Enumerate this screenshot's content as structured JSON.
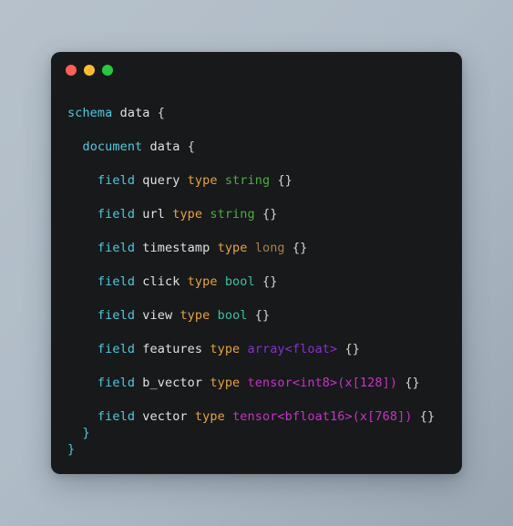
{
  "window": {
    "traffic_lights": [
      {
        "name": "close",
        "color": "#ff5f57"
      },
      {
        "name": "minimize",
        "color": "#febc2e"
      },
      {
        "name": "maximize",
        "color": "#28c840"
      }
    ]
  },
  "code": {
    "language": "vespa-schema",
    "lines": [
      {
        "id": "schema-open",
        "indent": 0,
        "spacing": "gap",
        "tokens": [
          {
            "text": "schema",
            "kind": "kw"
          },
          {
            "text": " ",
            "kind": "plain"
          },
          {
            "text": "data",
            "kind": "name"
          },
          {
            "text": " ",
            "kind": "plain"
          },
          {
            "text": "{",
            "kind": "brace"
          }
        ]
      },
      {
        "id": "document-open",
        "indent": 1,
        "spacing": "gap",
        "tokens": [
          {
            "text": "document",
            "kind": "kw"
          },
          {
            "text": " ",
            "kind": "plain"
          },
          {
            "text": "data",
            "kind": "name"
          },
          {
            "text": " ",
            "kind": "plain"
          },
          {
            "text": "{",
            "kind": "brace"
          }
        ]
      },
      {
        "id": "field-query",
        "indent": 2,
        "spacing": "gap",
        "tokens": [
          {
            "text": "field",
            "kind": "kw"
          },
          {
            "text": " ",
            "kind": "plain"
          },
          {
            "text": "query",
            "kind": "name"
          },
          {
            "text": " ",
            "kind": "plain"
          },
          {
            "text": "type",
            "kind": "type-kw"
          },
          {
            "text": " ",
            "kind": "plain"
          },
          {
            "text": "string",
            "kind": "string"
          },
          {
            "text": " ",
            "kind": "plain"
          },
          {
            "text": "{}",
            "kind": "brace"
          }
        ]
      },
      {
        "id": "field-url",
        "indent": 2,
        "spacing": "gap",
        "tokens": [
          {
            "text": "field",
            "kind": "kw"
          },
          {
            "text": " ",
            "kind": "plain"
          },
          {
            "text": "url",
            "kind": "name"
          },
          {
            "text": " ",
            "kind": "plain"
          },
          {
            "text": "type",
            "kind": "type-kw"
          },
          {
            "text": " ",
            "kind": "plain"
          },
          {
            "text": "string",
            "kind": "string"
          },
          {
            "text": " ",
            "kind": "plain"
          },
          {
            "text": "{}",
            "kind": "brace"
          }
        ]
      },
      {
        "id": "field-timestamp",
        "indent": 2,
        "spacing": "gap",
        "tokens": [
          {
            "text": "field",
            "kind": "kw"
          },
          {
            "text": " ",
            "kind": "plain"
          },
          {
            "text": "timestamp",
            "kind": "name"
          },
          {
            "text": " ",
            "kind": "plain"
          },
          {
            "text": "type",
            "kind": "type-kw"
          },
          {
            "text": " ",
            "kind": "plain"
          },
          {
            "text": "long",
            "kind": "long"
          },
          {
            "text": " ",
            "kind": "plain"
          },
          {
            "text": "{}",
            "kind": "brace"
          }
        ]
      },
      {
        "id": "field-click",
        "indent": 2,
        "spacing": "gap",
        "tokens": [
          {
            "text": "field",
            "kind": "kw"
          },
          {
            "text": " ",
            "kind": "plain"
          },
          {
            "text": "click",
            "kind": "name"
          },
          {
            "text": " ",
            "kind": "plain"
          },
          {
            "text": "type",
            "kind": "type-kw"
          },
          {
            "text": " ",
            "kind": "plain"
          },
          {
            "text": "bool",
            "kind": "bool"
          },
          {
            "text": " ",
            "kind": "plain"
          },
          {
            "text": "{}",
            "kind": "brace"
          }
        ]
      },
      {
        "id": "field-view",
        "indent": 2,
        "spacing": "gap",
        "tokens": [
          {
            "text": "field",
            "kind": "kw"
          },
          {
            "text": " ",
            "kind": "plain"
          },
          {
            "text": "view",
            "kind": "name"
          },
          {
            "text": " ",
            "kind": "plain"
          },
          {
            "text": "type",
            "kind": "type-kw"
          },
          {
            "text": " ",
            "kind": "plain"
          },
          {
            "text": "bool",
            "kind": "bool"
          },
          {
            "text": " ",
            "kind": "plain"
          },
          {
            "text": "{}",
            "kind": "brace"
          }
        ]
      },
      {
        "id": "field-features",
        "indent": 2,
        "spacing": "gap",
        "tokens": [
          {
            "text": "field",
            "kind": "kw"
          },
          {
            "text": " ",
            "kind": "plain"
          },
          {
            "text": "features",
            "kind": "name"
          },
          {
            "text": " ",
            "kind": "plain"
          },
          {
            "text": "type",
            "kind": "type-kw"
          },
          {
            "text": " ",
            "kind": "plain"
          },
          {
            "text": "array<float>",
            "kind": "array"
          },
          {
            "text": " ",
            "kind": "plain"
          },
          {
            "text": "{}",
            "kind": "brace"
          }
        ]
      },
      {
        "id": "field-b-vector",
        "indent": 2,
        "spacing": "gap",
        "tokens": [
          {
            "text": "field",
            "kind": "kw"
          },
          {
            "text": " ",
            "kind": "plain"
          },
          {
            "text": "b_vector",
            "kind": "name"
          },
          {
            "text": " ",
            "kind": "plain"
          },
          {
            "text": "type",
            "kind": "type-kw"
          },
          {
            "text": " ",
            "kind": "plain"
          },
          {
            "text": "tensor<int8>(x[128])",
            "kind": "tensor"
          },
          {
            "text": " ",
            "kind": "plain"
          },
          {
            "text": "{}",
            "kind": "brace"
          }
        ]
      },
      {
        "id": "field-vector",
        "indent": 2,
        "spacing": "tight",
        "tokens": [
          {
            "text": "field",
            "kind": "kw"
          },
          {
            "text": " ",
            "kind": "plain"
          },
          {
            "text": "vector",
            "kind": "name"
          },
          {
            "text": " ",
            "kind": "plain"
          },
          {
            "text": "type",
            "kind": "type-kw"
          },
          {
            "text": " ",
            "kind": "plain"
          },
          {
            "text": "tensor<bfloat16>(x[768])",
            "kind": "tensor"
          },
          {
            "text": " ",
            "kind": "plain"
          },
          {
            "text": "{}",
            "kind": "brace"
          }
        ]
      },
      {
        "id": "document-close",
        "indent": 1,
        "spacing": "tight",
        "tokens": [
          {
            "text": "}",
            "kind": "close"
          }
        ]
      },
      {
        "id": "schema-close",
        "indent": 0,
        "spacing": "tight",
        "tokens": [
          {
            "text": "}",
            "kind": "close"
          }
        ]
      }
    ]
  }
}
